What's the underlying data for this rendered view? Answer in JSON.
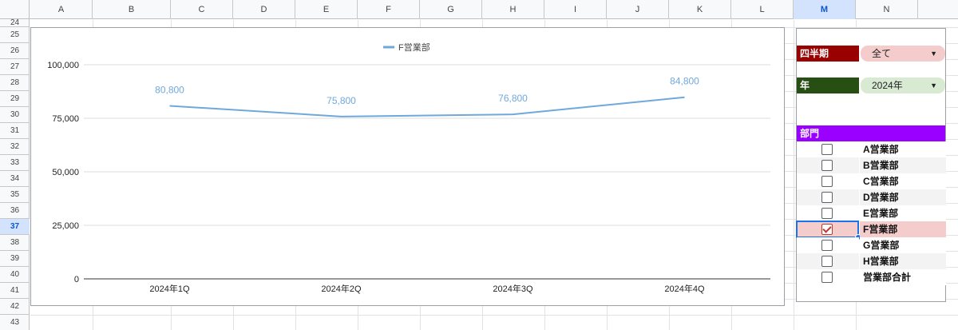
{
  "columns": [
    "A",
    "B",
    "C",
    "D",
    "E",
    "F",
    "G",
    "H",
    "I",
    "J",
    "K",
    "L",
    "M",
    "N"
  ],
  "active_column": "M",
  "rows": [
    "24",
    "25",
    "26",
    "27",
    "28",
    "29",
    "30",
    "31",
    "32",
    "33",
    "34",
    "35",
    "36",
    "37",
    "38",
    "39",
    "40",
    "41",
    "42",
    "43"
  ],
  "active_row": "37",
  "chart_data": {
    "type": "line",
    "categories": [
      "2024年1Q",
      "2024年2Q",
      "2024年3Q",
      "2024年4Q"
    ],
    "series": [
      {
        "name": "F営業部",
        "values": [
          80800,
          75800,
          76800,
          84800
        ],
        "color": "#6fa8dc"
      }
    ],
    "data_labels": [
      "80,800",
      "75,800",
      "76,800",
      "84,800"
    ],
    "y_ticks": [
      "0",
      "25,000",
      "50,000",
      "75,000",
      "100,000"
    ],
    "ylim": [
      0,
      100000
    ],
    "legend_position": "top",
    "grid": true
  },
  "filters": {
    "quarter": {
      "label": "四半期",
      "value": "全て",
      "label_bg": "#990000",
      "dd_bg": "#f4cccc"
    },
    "year": {
      "label": "年",
      "value": "2024年",
      "label_bg": "#274e13",
      "dd_bg": "#d9ead3"
    }
  },
  "dept_header": "部門",
  "departments": [
    {
      "name": "A営業部",
      "checked": false
    },
    {
      "name": "B営業部",
      "checked": false
    },
    {
      "name": "C営業部",
      "checked": false
    },
    {
      "name": "D営業部",
      "checked": false
    },
    {
      "name": "E営業部",
      "checked": false
    },
    {
      "name": "F営業部",
      "checked": true
    },
    {
      "name": "G営業部",
      "checked": false
    },
    {
      "name": "H営業部",
      "checked": false
    },
    {
      "name": "営業部合計",
      "checked": false
    }
  ],
  "dropdown_arrow": "▼"
}
